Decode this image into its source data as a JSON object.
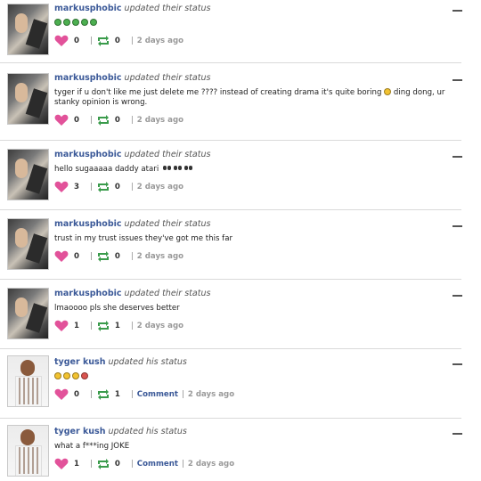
{
  "posts": [
    {
      "user": "markusphobic",
      "verb": "updated their status",
      "content": "",
      "emojis": [
        "g",
        "g",
        "g",
        "g",
        "g"
      ],
      "likes": "0",
      "reposts": "0",
      "comment": "",
      "time": "2 days ago"
    },
    {
      "user": "markusphobic",
      "verb": "updated their status",
      "content": "tyger if u don't like me just delete me ???? instead of creating drama it's quite boring",
      "content2": " ding dong, ur stanky opinion is wrong.",
      "emojis": [],
      "likes": "0",
      "reposts": "0",
      "comment": "",
      "time": "2 days ago"
    },
    {
      "user": "markusphobic",
      "verb": "updated their status",
      "content": "hello sugaaaaa daddy atari",
      "emojis": [],
      "likes": "3",
      "reposts": "0",
      "comment": "",
      "time": "2 days ago"
    },
    {
      "user": "markusphobic",
      "verb": "updated their status",
      "content": "trust in my trust issues they've got me this far",
      "emojis": [],
      "likes": "0",
      "reposts": "0",
      "comment": "",
      "time": "2 days ago"
    },
    {
      "user": "markusphobic",
      "verb": "updated their status",
      "content": "lmaoooo pls she deserves better",
      "emojis": [],
      "likes": "1",
      "reposts": "1",
      "comment": "",
      "time": "2 days ago"
    },
    {
      "user": "tyger kush",
      "verb": "updated his status",
      "content": "",
      "emojis": [
        "y",
        "y",
        "y",
        "r"
      ],
      "likes": "0",
      "reposts": "1",
      "comment": "Comment",
      "time": "2 days ago"
    },
    {
      "user": "tyger kush",
      "verb": "updated his status",
      "content": "what a f***ing JOKE",
      "emojis": [],
      "likes": "1",
      "reposts": "0",
      "comment": "Comment",
      "time": "2 days ago"
    }
  ],
  "colors": {
    "like": "#e2529a",
    "repost": "#3a9b4b",
    "link": "#3b5998"
  },
  "icons": {
    "like": "heart-icon",
    "repost": "repost-icon",
    "collapse": "minus-icon"
  }
}
